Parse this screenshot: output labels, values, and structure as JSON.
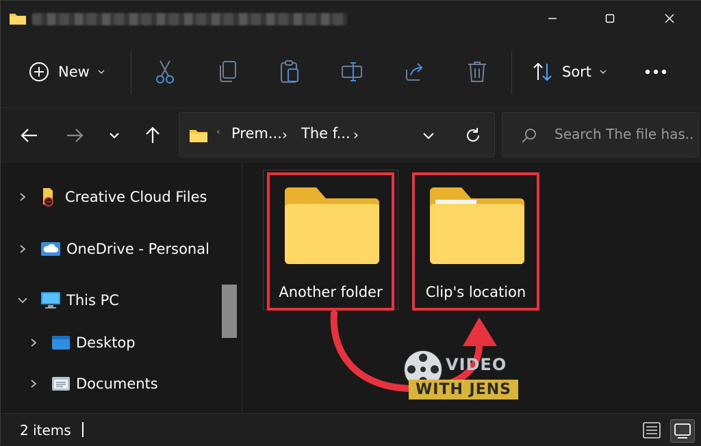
{
  "window": {
    "title_obscured": true,
    "controls": [
      "minimize-icon",
      "maximize-icon",
      "close-icon"
    ]
  },
  "toolbar": {
    "new_label": "New",
    "sort_label": "Sort",
    "icons": [
      "cut-icon",
      "copy-icon",
      "paste-icon",
      "rename-icon",
      "share-icon",
      "delete-icon",
      "more-icon"
    ]
  },
  "address": {
    "crumb1": "Prem...",
    "crumb2": "The f...",
    "search_placeholder": "Search The file has..."
  },
  "sidebar": {
    "items": [
      {
        "label": "Creative Cloud Files",
        "icon": "creative-cloud-folder-icon",
        "expanded": false
      },
      {
        "label": "OneDrive - Personal",
        "icon": "onedrive-icon",
        "expanded": false
      },
      {
        "label": "This PC",
        "icon": "pc-icon",
        "expanded": true
      },
      {
        "label": "Desktop",
        "icon": "desktop-folder-icon",
        "expanded": false
      },
      {
        "label": "Documents",
        "icon": "documents-folder-icon",
        "expanded": false
      }
    ]
  },
  "content": {
    "folders": [
      {
        "name": "Another folder"
      },
      {
        "name": "Clip's location"
      }
    ],
    "highlight_color": "#e8333f"
  },
  "status": {
    "count_text": "2 items"
  },
  "watermark": {
    "line1": "VIDEO",
    "line2": "WITH JENS"
  },
  "colors": {
    "accent_blue": "#4da3ff",
    "folder_yellow": "#f6c944"
  }
}
